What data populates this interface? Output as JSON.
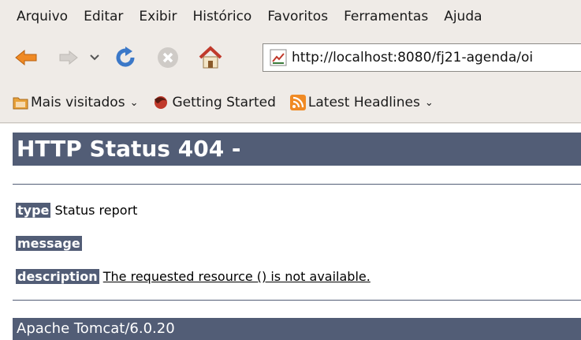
{
  "menu": [
    "Arquivo",
    "Editar",
    "Exibir",
    "Histórico",
    "Favoritos",
    "Ferramentas",
    "Ajuda"
  ],
  "navigation": {
    "address_url": "http://localhost:8080/fj21-agenda/oi",
    "icons": [
      "back-arrow-icon",
      "forward-arrow-icon",
      "dropdown-chevron-icon",
      "reload-icon",
      "stop-icon",
      "home-icon",
      "page-favicon-icon"
    ]
  },
  "bookmarks": [
    {
      "label": "Mais visitados",
      "icon": "folder-icon",
      "has_dropdown": true
    },
    {
      "label": "Getting Started",
      "icon": "firefox-icon",
      "has_dropdown": false
    },
    {
      "label": "Latest Headlines",
      "icon": "rss-icon",
      "has_dropdown": true
    }
  ],
  "page": {
    "title": "HTTP Status 404 -",
    "type_label": "type",
    "type_value": "Status report",
    "message_label": "message",
    "message_value": "",
    "description_label": "description",
    "description_value": "The requested resource () is not available.",
    "footer": "Apache Tomcat/6.0.20"
  },
  "colors": {
    "tomcat_bar": "#525d76",
    "chrome_bg": "#efebe7",
    "back_arrow": "#f08a24",
    "reload_blue": "#3b78c8"
  }
}
